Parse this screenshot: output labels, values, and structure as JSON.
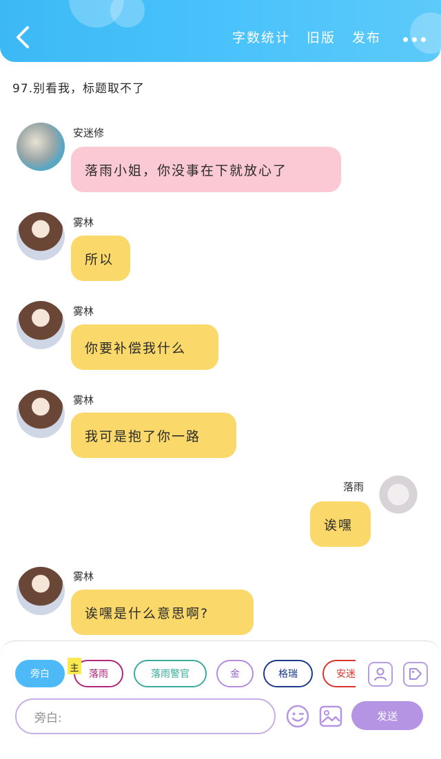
{
  "header": {
    "stats": "字数统计",
    "old_version": "旧版",
    "publish": "发布"
  },
  "chapter_title": "97.别看我，标题取不了",
  "messages": [
    {
      "speaker": "安迷修",
      "text": "落雨小姐，你没事在下就放心了",
      "bubble_color": "#fbc9d3"
    },
    {
      "speaker": "雾林",
      "text": "所以",
      "bubble_color": "#fad869"
    },
    {
      "speaker": "雾林",
      "text": "你要补偿我什么",
      "bubble_color": "#fad869"
    },
    {
      "speaker": "雾林",
      "text": "我可是抱了你一路",
      "bubble_color": "#fad869"
    },
    {
      "speaker": "落雨",
      "text": "诶嘿",
      "bubble_color": "#fad869"
    },
    {
      "speaker": "雾林",
      "text": "诶嘿是什么意思啊?",
      "bubble_color": "#fad869"
    }
  ],
  "roles": {
    "main_tag": "主",
    "items": [
      {
        "label": "旁白",
        "color": "#4dbaf7"
      },
      {
        "label": "落雨",
        "color": "#b0267a"
      },
      {
        "label": "落雨警官",
        "color": "#3aab9d"
      },
      {
        "label": "金",
        "color": "#9b63c9"
      },
      {
        "label": "格瑞",
        "color": "#1c3a8a"
      },
      {
        "label": "安迷",
        "color": "#d9342b"
      }
    ]
  },
  "input": {
    "placeholder": "旁白:"
  },
  "send_label": "发送",
  "accent": "#4dbaf7"
}
